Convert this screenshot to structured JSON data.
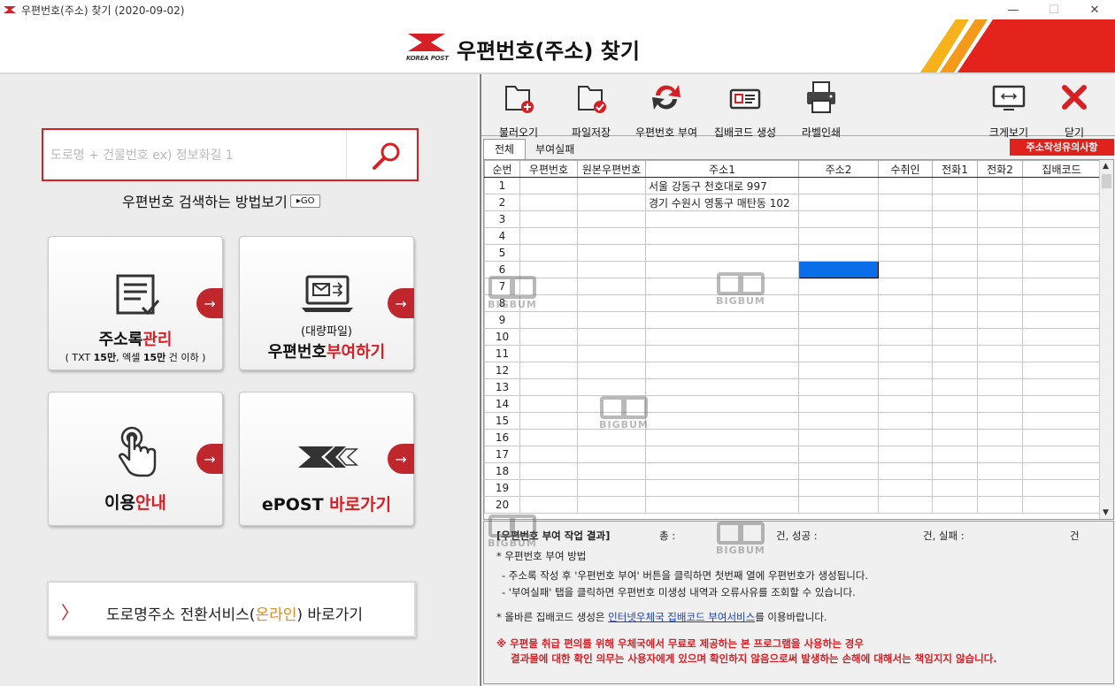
{
  "window": {
    "title": "우편번호(주소) 찾기 (2020-09-02)",
    "min": "—",
    "max": "☐",
    "close": "✕"
  },
  "header": {
    "title": "우편번호(주소) 찾기",
    "logo_text": "KOREA POST"
  },
  "search": {
    "placeholder": "도로명 + 건물번호 ex) 정보화길 1",
    "howto": "우편번호 검색하는 방법보기",
    "go": "▸GO"
  },
  "cards": {
    "address_book": {
      "label_a": "주소록",
      "label_b": "관리",
      "sub_a": "( TXT ",
      "sub_b": "15만",
      "sub_c": ", 엑셀 ",
      "sub_d": "15만",
      "sub_e": " 건 이하 )"
    },
    "bulk": {
      "line1": "(대량파일)",
      "label_a": "우편번호",
      "label_b": "부여하기"
    },
    "guide": {
      "label_a": "이용",
      "label_b": "안내"
    },
    "epost": {
      "label_a": "ePOST ",
      "label_b": "바로가기"
    },
    "arrow": "→"
  },
  "road_service": {
    "chev": "〉",
    "text_a": "도로명주소 전환서비스(",
    "text_b": "온라인",
    "text_c": ") 바로가기"
  },
  "toolbar": [
    {
      "label": "불러오기",
      "icon": "folder-open-icon"
    },
    {
      "label": "파일저장",
      "icon": "folder-save-icon"
    },
    {
      "label": "우편번호 부여",
      "icon": "refresh-icon"
    },
    {
      "label": "집배코드 생성",
      "icon": "code-card-icon"
    },
    {
      "label": "라벨인쇄",
      "icon": "printer-icon"
    },
    {
      "label": "크게보기",
      "icon": "expand-icon"
    },
    {
      "label": "닫기",
      "icon": "close-icon"
    }
  ],
  "tabs": {
    "all": "전체",
    "failed": "부여실패",
    "notice_button": "주소작성유의사항"
  },
  "grid": {
    "headers": [
      "순번",
      "우편번호",
      "원본우편번호",
      "주소1",
      "주소2",
      "수취인",
      "전화1",
      "전화2",
      "집배코드"
    ],
    "rows": [
      {
        "n": "1",
        "addr1": "서울 강동구 천호대로 997"
      },
      {
        "n": "2",
        "addr1": "경기 수원시 영통구 매탄동 102"
      },
      {
        "n": "3",
        "addr1": ""
      },
      {
        "n": "4",
        "addr1": ""
      },
      {
        "n": "5",
        "addr1": ""
      },
      {
        "n": "6",
        "addr1": ""
      },
      {
        "n": "7",
        "addr1": ""
      },
      {
        "n": "8",
        "addr1": ""
      },
      {
        "n": "9",
        "addr1": ""
      },
      {
        "n": "10",
        "addr1": ""
      },
      {
        "n": "11",
        "addr1": ""
      },
      {
        "n": "12",
        "addr1": ""
      },
      {
        "n": "13",
        "addr1": ""
      },
      {
        "n": "14",
        "addr1": ""
      },
      {
        "n": "15",
        "addr1": ""
      },
      {
        "n": "16",
        "addr1": ""
      },
      {
        "n": "17",
        "addr1": ""
      },
      {
        "n": "18",
        "addr1": ""
      },
      {
        "n": "19",
        "addr1": ""
      },
      {
        "n": "20",
        "addr1": ""
      }
    ],
    "selected_row": 6
  },
  "result": {
    "title": "[우편번호 부여 작업 결과]",
    "total_label": "총 :",
    "unit1": "건, 성공 :",
    "unit2": "건, 실패 :",
    "unit3": "건",
    "method_title": "* 우편번호 부여 방법",
    "line1": "- 주소록 작성 후 '우편번호 부여' 버튼을 클릭하면 첫번째 열에 우편번호가 생성됩니다.",
    "line2": "- '부여실패' 탭을 클릭하면 우편번호 미생성 내역과 오류사유를 조회할 수 있습니다.",
    "code_pre": "* 올바른 집배코드 생성은 ",
    "code_link": "인터넷우체국 집배코드 부여서비스",
    "code_post": "를 이용바랍니다.",
    "warn1": "※ 우편물 취급 편의를 위해 우체국에서 무료로 제공하는 본 프로그램을 사용하는 경우",
    "warn2": "결과물에 대한 확인 의무는 사용자에게 있으며 확인하지 않음으로써 발생하는 손해에 대해서는 책임지지 않습니다."
  },
  "watermark": "BIGBUM"
}
